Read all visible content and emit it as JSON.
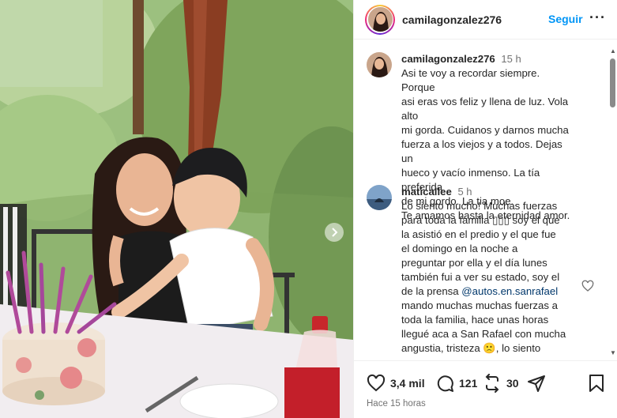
{
  "post": {
    "username": "camilagonzalez276",
    "follow_label": "Seguir",
    "more_label": "···"
  },
  "comments": [
    {
      "username": "camilagonzalez276",
      "time": "15 h",
      "lines": [
        "Asi te voy a recordar siempre. Porque",
        "asi eras vos feliz y llena de luz. Vola alto",
        "mi gorda. Cuidanos y darnos mucha",
        "fuerza a los viejos y a todos. Dejas un",
        "hueco y vacío inmenso. La tía preferida",
        "de mi gordo. La tia moe.",
        "Te amamos hasta la eternidad amor."
      ]
    },
    {
      "username": "maticallee",
      "time": "5 h",
      "lines": [
        "Lo siento mucho! Muchas fuerzas",
        "para toda la familia ▯▯▯ soy el que",
        "la asistió en el predio y el que fue",
        "el domingo en la noche a",
        "preguntar por ella y el día lunes",
        "también fui a ver su estado, soy el",
        "de la prensa"
      ],
      "mention": "@autos.en.sanrafael",
      "lines_after": [
        "mando muchas muchas fuerzas a",
        "toda la familia, hace unas horas",
        "llegué aca a San Rafael con mucha",
        "angustia, tristeza 🙁, lo siento"
      ]
    }
  ],
  "actions": {
    "likes": "3,4 mil",
    "comments": "121",
    "reposts": "30",
    "timestamp": "Hace 15 horas"
  },
  "colors": {
    "follow": "#0095f6",
    "mention": "#00376b",
    "muted": "#737373"
  },
  "icons": [
    "heart-icon",
    "comment-icon",
    "repost-icon",
    "share-icon",
    "bookmark-icon",
    "more-icon",
    "chevron-right-icon"
  ]
}
